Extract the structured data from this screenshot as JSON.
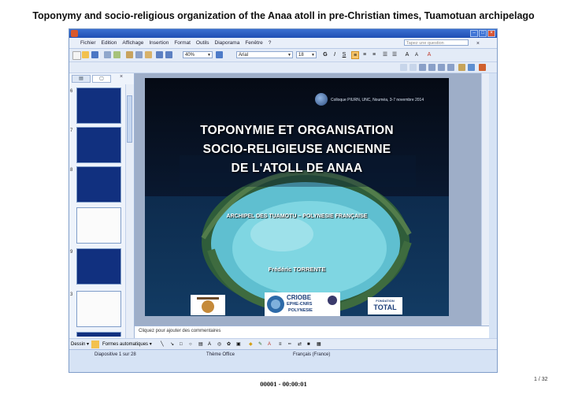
{
  "page": {
    "title": "Toponymy and socio-religious organization of the Anaa atoll in pre-Christian times, Tuamotuan archipelago",
    "footer_label": "00001 - 00:00:01",
    "page_number": "1 / 32"
  },
  "menubar": {
    "items": [
      "Fichier",
      "Edition",
      "Affichage",
      "Insertion",
      "Format",
      "Outils",
      "Diaporama",
      "Fenêtre",
      "?"
    ],
    "ask_placeholder": "Tapez une question"
  },
  "toolbar": {
    "zoom": "40%",
    "font_name": "Arial",
    "font_size": "18",
    "bold": "G",
    "italic": "I",
    "underline": "S"
  },
  "left_pane": {
    "tab_icons": [
      "outline-icon",
      "slides-icon"
    ],
    "thumbnail_numbers": [
      "6",
      "7",
      "8",
      "",
      "9",
      "3"
    ]
  },
  "slide": {
    "conference": "Colloque PIURN, UNC, Nouméa, 3-7 novembre 2014",
    "title_lines": [
      "TOPONYMIE ET ORGANISATION",
      "SOCIO-RELIGIEUSE ANCIENNE",
      "DE L'ATOLL DE ANAA"
    ],
    "subtitle": "ARCHIPEL DES TUAMOTU – POLYNESIE FRANÇAISE",
    "author": "Frédéric TORRENTE",
    "logo_criobe": [
      "CRIOBE",
      "EPHE-CNRS",
      "POLYNESIE"
    ],
    "logo_total": [
      "FONDATION",
      "TOTAL"
    ]
  },
  "notes": {
    "placeholder": "Cliquez pour ajouter des commentaires"
  },
  "drawbar": {
    "draw_label": "Dessin ▾",
    "autoshapes_label": "Formes automatiques ▾"
  },
  "statusbar": {
    "slide_counter": "Diapositive 1 sur 28",
    "theme": "Thème Office",
    "language": "Français (France)"
  },
  "colors": {
    "slide_bg": "#0a1a33",
    "titlebar": "#1f4fb4",
    "app_bg": "#d6e3f5"
  }
}
